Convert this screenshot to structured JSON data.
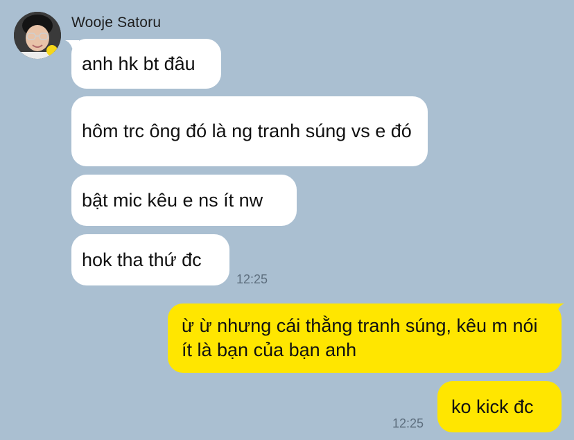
{
  "chat": {
    "sender": {
      "name": "Wooje Satoru",
      "avatar_icon": "profile-photo"
    },
    "incoming": [
      {
        "text": "anh hk bt đâu"
      },
      {
        "text": "hôm trc ông đó là ng tranh súng vs e đó"
      },
      {
        "text": "bật mic kêu e ns ít nw"
      },
      {
        "text": "hok tha thứ đc"
      }
    ],
    "incoming_time": "12:25",
    "outgoing": [
      {
        "text": "ừ ừ nhưng cái thằng tranh súng, kêu m nói ít là bạn của bạn anh"
      },
      {
        "text": "ko kick đc"
      }
    ],
    "outgoing_time": "12:25"
  },
  "colors": {
    "background": "#aabfd1",
    "incoming_bubble": "#ffffff",
    "outgoing_bubble": "#ffe600"
  }
}
